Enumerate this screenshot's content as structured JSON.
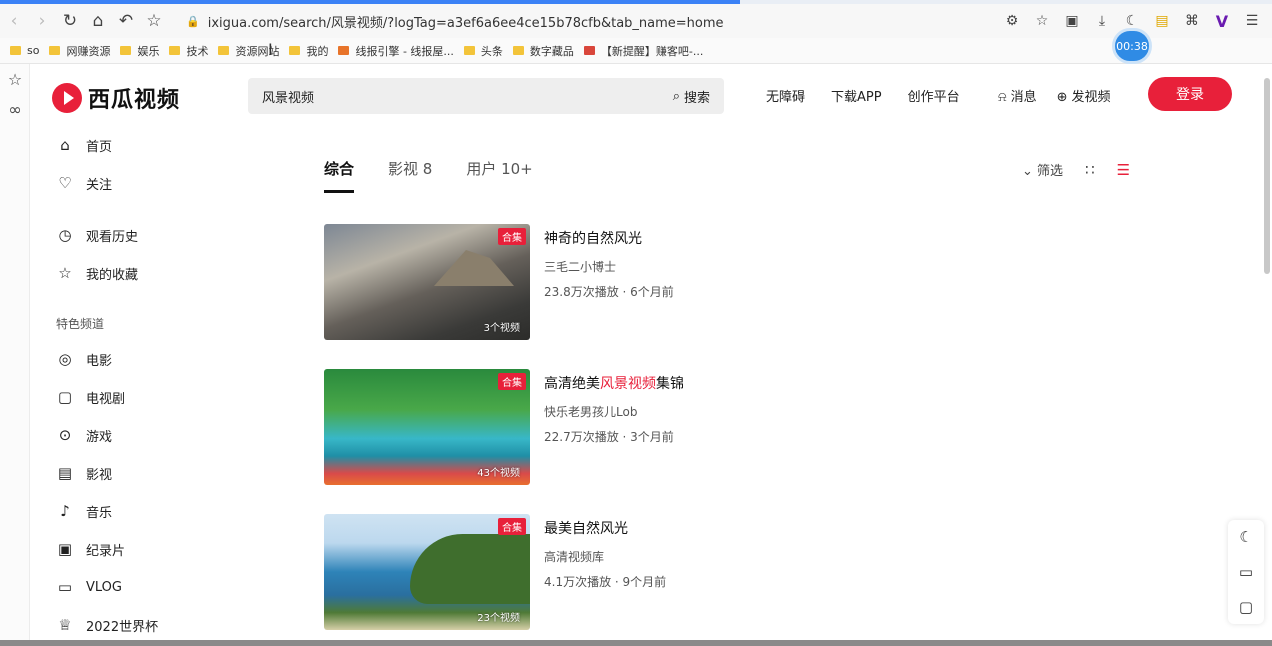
{
  "browser": {
    "url": "ixigua.com/search/风景视频/?logTag=a3ef6a6ee4ce15b78cfb&tab_name=home",
    "timer": "00:38",
    "bookmarks": [
      {
        "label": "so"
      },
      {
        "label": "网赚资源"
      },
      {
        "label": "娱乐"
      },
      {
        "label": "技术"
      },
      {
        "label": "资源网站"
      },
      {
        "label": "我的"
      },
      {
        "label": "线报引擎 - 线报屋..."
      },
      {
        "label": "头条"
      },
      {
        "label": "数字藏品"
      },
      {
        "label": "【新提醒】赚客吧-..."
      }
    ]
  },
  "header": {
    "logo_text": "西瓜视频",
    "search_value": "风景视频",
    "search_button": "搜索",
    "nav": [
      "无障碍",
      "下载APP",
      "创作平台"
    ],
    "messages": "消息",
    "upload": "发视频",
    "login": "登录"
  },
  "sidebar": {
    "items_top": [
      "首页",
      "关注"
    ],
    "items_mid": [
      "观看历史",
      "我的收藏"
    ],
    "section_title": "特色频道",
    "channels": [
      "电影",
      "电视剧",
      "游戏",
      "影视",
      "音乐",
      "纪录片",
      "VLOG",
      "2022世界杯"
    ]
  },
  "tabs": [
    {
      "label": "综合",
      "active": true
    },
    {
      "label": "影视 8",
      "active": false
    },
    {
      "label": "用户 10+",
      "active": false
    }
  ],
  "tools": {
    "filter": "筛选"
  },
  "results": [
    {
      "title": "神奇的自然风光",
      "title_pre": "",
      "title_hl": "",
      "title_post": "",
      "author": "三毛二小博士",
      "meta": "23.8万次播放 · 6个月前",
      "tag": "合集",
      "count": "3个视频"
    },
    {
      "title": "",
      "title_pre": "高清绝美",
      "title_hl": "风景视频",
      "title_post": "集锦",
      "author": "快乐老男孩儿Lob",
      "meta": "22.7万次播放 · 3个月前",
      "tag": "合集",
      "count": "43个视频"
    },
    {
      "title": "最美自然风光",
      "title_pre": "",
      "title_hl": "",
      "title_post": "",
      "author": "高清视频库",
      "meta": "4.1万次播放 · 9个月前",
      "tag": "合集",
      "count": "23个视频"
    }
  ],
  "colors": {
    "accent": "#e8203a"
  }
}
